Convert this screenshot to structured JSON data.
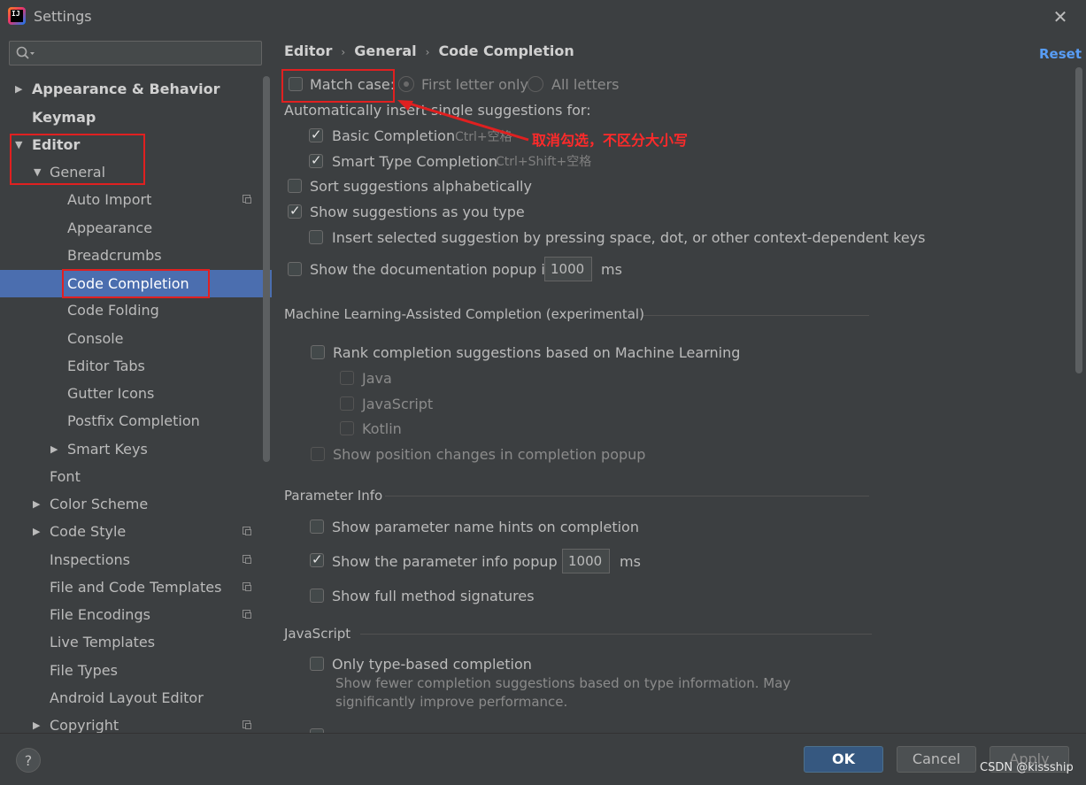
{
  "window": {
    "title": "Settings",
    "close_glyph": "✕"
  },
  "search": {
    "placeholder": ""
  },
  "sidebar": {
    "items": [
      {
        "label": "Appearance & Behavior"
      },
      {
        "label": "Keymap"
      },
      {
        "label": "Editor"
      },
      {
        "label": "General"
      },
      {
        "label": "Auto Import"
      },
      {
        "label": "Appearance"
      },
      {
        "label": "Breadcrumbs"
      },
      {
        "label": "Code Completion"
      },
      {
        "label": "Code Folding"
      },
      {
        "label": "Console"
      },
      {
        "label": "Editor Tabs"
      },
      {
        "label": "Gutter Icons"
      },
      {
        "label": "Postfix Completion"
      },
      {
        "label": "Smart Keys"
      },
      {
        "label": "Font"
      },
      {
        "label": "Color Scheme"
      },
      {
        "label": "Code Style"
      },
      {
        "label": "Inspections"
      },
      {
        "label": "File and Code Templates"
      },
      {
        "label": "File Encodings"
      },
      {
        "label": "Live Templates"
      },
      {
        "label": "File Types"
      },
      {
        "label": "Android Layout Editor"
      },
      {
        "label": "Copyright"
      }
    ],
    "selected": "Code Completion"
  },
  "breadcrumb": {
    "editor": "Editor",
    "general": "General",
    "page": "Code Completion",
    "sep": "›"
  },
  "reset_label": "Reset",
  "match_case": {
    "label": "Match case:",
    "checked": false,
    "first_letter": "First letter only",
    "all_letters": "All letters"
  },
  "auto_insert": {
    "label": "Automatically insert single suggestions for:",
    "basic": "Basic Completion",
    "basic_shortcut": "Ctrl+空格",
    "smart": "Smart Type Completion",
    "smart_shortcut": "Ctrl+Shift+空格"
  },
  "options": {
    "sort_alpha": "Sort suggestions alphabetically",
    "show_as_type": "Show suggestions as you type",
    "insert_by_space": "Insert selected suggestion by pressing space, dot, or other context-dependent keys",
    "doc_popup": "Show the documentation popup in",
    "doc_popup_ms": "1000",
    "ms": "ms"
  },
  "ml": {
    "section": "Machine Learning-Assisted Completion (experimental)",
    "rank": "Rank completion suggestions based on Machine Learning",
    "java": "Java",
    "javascript": "JavaScript",
    "kotlin": "Kotlin",
    "position_changes": "Show position changes in completion popup"
  },
  "param": {
    "section": "Parameter Info",
    "name_hints": "Show parameter name hints on completion",
    "info_popup": "Show the parameter info popup in",
    "info_popup_ms": "1000",
    "full_signatures": "Show full method signatures"
  },
  "js": {
    "section": "JavaScript",
    "type_based": "Only type-based completion",
    "type_based_desc": "Show fewer completion suggestions based on type information. May significantly improve performance."
  },
  "annotation": {
    "text": "取消勾选，不区分大小写",
    "color": "#ff2a2a"
  },
  "footer": {
    "help": "?",
    "ok": "OK",
    "cancel": "Cancel",
    "apply": "Apply",
    "watermark": "CSDN @kissship"
  },
  "colors": {
    "background": "#3c3f41",
    "selection": "#4b6eaf",
    "accent": "#589df6",
    "ok_button": "#365880"
  }
}
